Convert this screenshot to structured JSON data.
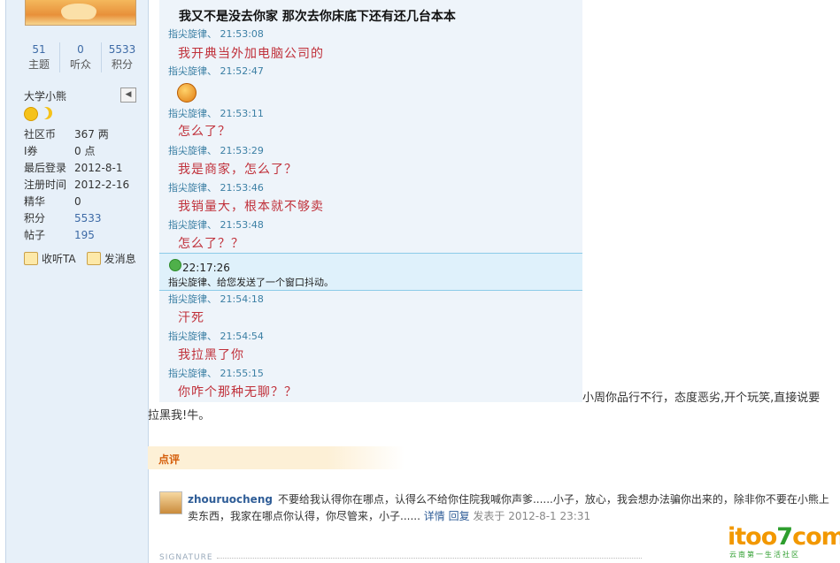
{
  "sidebar": {
    "stats": [
      {
        "num": "51",
        "label": "主题"
      },
      {
        "num": "0",
        "label": "听众"
      },
      {
        "num": "5533",
        "label": "积分"
      }
    ],
    "group": "大学小熊",
    "info": [
      {
        "k": "社区币",
        "v": "367 两"
      },
      {
        "k": "I券",
        "v": "0 点"
      },
      {
        "k": "最后登录",
        "v": "2012-8-1"
      },
      {
        "k": "注册时间",
        "v": "2012-2-16"
      },
      {
        "k": "精华",
        "v": "0"
      },
      {
        "k": "积分",
        "v": "5533"
      },
      {
        "k": "帖子",
        "v": "195"
      }
    ],
    "actions": {
      "follow": "收听TA",
      "message": "发消息"
    }
  },
  "chat": {
    "top_message": "我又不是没去你家  那次去你床底下还有还几台本本",
    "lines": [
      {
        "who": "指尖旋律、  21:53:08",
        "msg": "我开典当外加电脑公司的"
      },
      {
        "who": "指尖旋律、  21:52:47",
        "msg": ""
      },
      {
        "who": "指尖旋律、  21:53:11",
        "msg": "怎么了？"
      },
      {
        "who": "指尖旋律、  21:53:29",
        "msg": "我是商家，怎么了？"
      },
      {
        "who": "指尖旋律、  21:53:46",
        "msg": "我销量大，根本就不够卖"
      },
      {
        "who": "指尖旋律、  21:53:48",
        "msg": "怎么了？？"
      },
      {
        "who": "指尖旋律、  21:54:18",
        "msg": "汗死"
      },
      {
        "who": "指尖旋律、  21:54:54",
        "msg": "我拉黑了你"
      },
      {
        "who": "指尖旋律、  21:55:15",
        "msg": "你咋个那种无聊？？"
      }
    ],
    "shake_time": "22:17:26",
    "shake_note": "指尖旋律、给您发送了一个窗口抖动。"
  },
  "post": {
    "trailing_1": "小周你品行不行，态度恶劣,开个玩笑,直接说要",
    "trailing_2": "拉黑我!牛。"
  },
  "review": {
    "title": "点评",
    "user": "zhouruocheng",
    "text": "不要给我认得你在哪点，认得么不给你住院我喊你声爹......小子，放心，我会想办法骗你出来的，除非你不要在小熊上卖东西，我家在哪点你认得，你尽管来，小子......",
    "detail": "详情",
    "reply": "回复",
    "time": "发表于 2012-8-1 23:31"
  },
  "signature_label": "SIGNATURE",
  "logo": {
    "text_a": "itoo",
    "text_b": "7",
    "text_c": "com",
    "tagline": "云南第一生活社区"
  }
}
